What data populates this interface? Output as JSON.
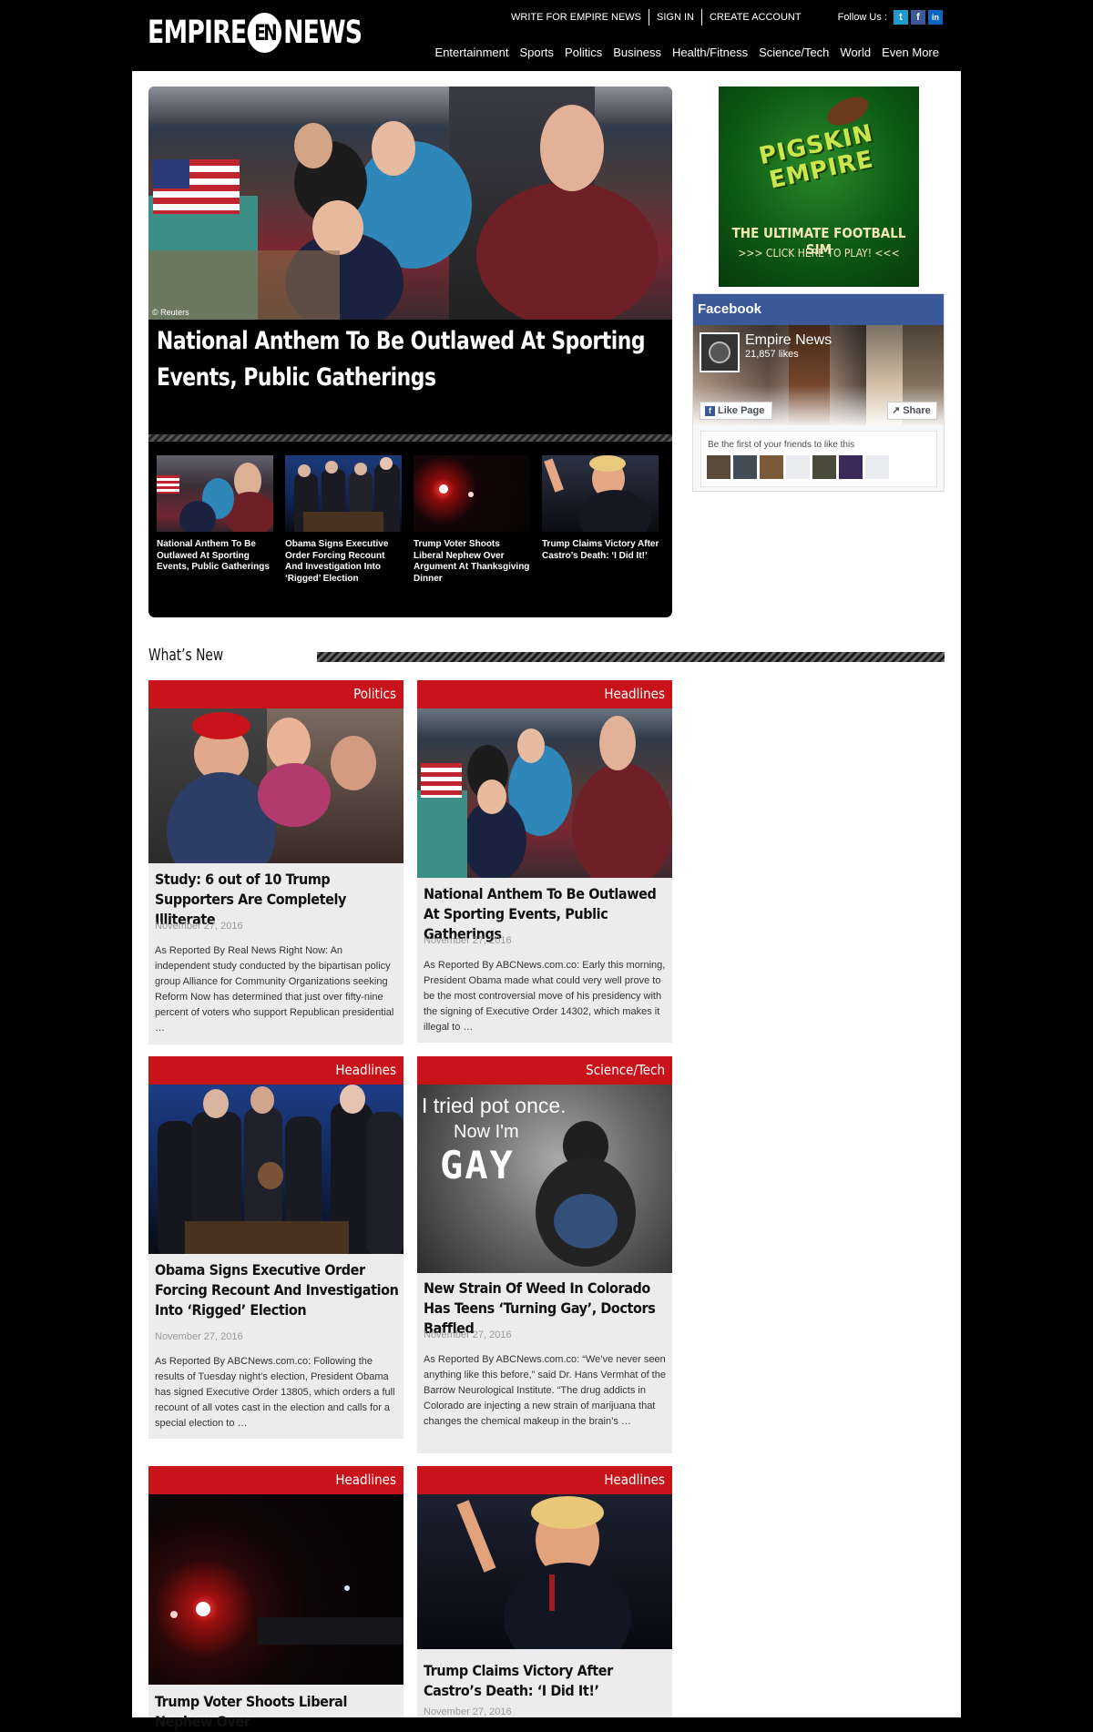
{
  "header": {
    "logo_left": "EMPIRE",
    "logo_mark": "EN",
    "logo_right": "NEWS",
    "top_links": [
      "WRITE FOR EMPIRE NEWS",
      "SIGN IN",
      "CREATE ACCOUNT"
    ],
    "follow_label": "Follow Us :",
    "social": [
      {
        "name": "twitter",
        "glyph": "t",
        "color": "#1d9bd1"
      },
      {
        "name": "facebook",
        "glyph": "f",
        "color": "#3b5998"
      },
      {
        "name": "linkedin",
        "glyph": "in",
        "color": "#0a66c2"
      }
    ],
    "nav": [
      "Entertainment",
      "Sports",
      "Politics",
      "Business",
      "Health/Fitness",
      "Science/Tech",
      "World",
      "Even More"
    ]
  },
  "featured": {
    "photo_credit": "© Reuters",
    "title": "National Anthem To Be Outlawed At Sporting Events, Public Gatherings",
    "thumbs": [
      {
        "caption": "National Anthem To Be Outlawed At Sporting Events, Public Gatherings"
      },
      {
        "caption": "Obama Signs Executive Order Forcing Recount And Investigation Into ‘Rigged’ Election"
      },
      {
        "caption": "Trump Voter Shoots Liberal Nephew Over Argument At Thanksgiving Dinner"
      },
      {
        "caption": "Trump Claims Victory After Castro’s Death: ‘I Did It!’"
      }
    ]
  },
  "ad": {
    "title_line1": "PIGSKIN",
    "title_line2": "EMPIRE",
    "tagline": "THE ULTIMATE FOOTBALL SIM",
    "cta": ">>> CLICK HERE TO PLAY! <<<"
  },
  "facebook": {
    "header": "Facebook",
    "page_name": "Empire News",
    "likes": "21,857 likes",
    "like_button": "Like Page",
    "share_button": "Share",
    "friends_text": "Be the first of your friends to like this"
  },
  "whats_new": {
    "heading": "What’s New",
    "cards": [
      {
        "category": "Politics",
        "title": "Study: 6 out of 10 Trump Supporters Are Completely Illiterate",
        "date": "November 27, 2016",
        "excerpt": "As Reported By Real News Right Now: An independent study conducted by the bipartisan policy group Alliance for Community Organizations seeking Reform Now has determined that just over fifty-nine percent of voters who support Republican presidential …"
      },
      {
        "category": "Headlines",
        "title": "National Anthem To Be Outlawed At Sporting Events, Public Gatherings",
        "date": "November 27, 2016",
        "excerpt": "As Reported By ABCNews.com.co: Early this morning, President Obama made what could very well prove to be the most controversial move of his presidency with the signing of Executive Order 14302, which makes it illegal to …"
      },
      {
        "category": "Headlines",
        "title": "Obama Signs Executive Order Forcing Recount And Investigation Into ‘Rigged’ Election",
        "date": "November 27, 2016",
        "excerpt": "As Reported By ABCNews.com.co: Following the results of Tuesday night’s election, President Obama has signed Executive Order 13805, which orders a full recount of all votes cast in the election and calls for a special election to …"
      },
      {
        "category": "Science/Tech",
        "title": "New Strain Of Weed In Colorado Has Teens ‘Turning Gay’, Doctors Baffled",
        "date": "November 27, 2016",
        "excerpt": "As Reported By ABCNews.com.co: “We’ve never seen anything like this before,” said Dr. Hans Vermhat of the Barrow Neurological Institute. “The drug addicts in Colorado are injecting a new strain of marijuana that changes the chemical makeup in the brain’s …",
        "image_text": [
          "I tried pot once.",
          "Now I'm",
          "GAY"
        ]
      },
      {
        "category": "Headlines",
        "title": "Trump Voter Shoots Liberal Nephew Over",
        "date": "",
        "excerpt": ""
      },
      {
        "category": "Headlines",
        "title": "Trump Claims Victory After Castro’s Death: ‘I Did It!’",
        "date": "November 27, 2016",
        "excerpt": ""
      }
    ]
  }
}
